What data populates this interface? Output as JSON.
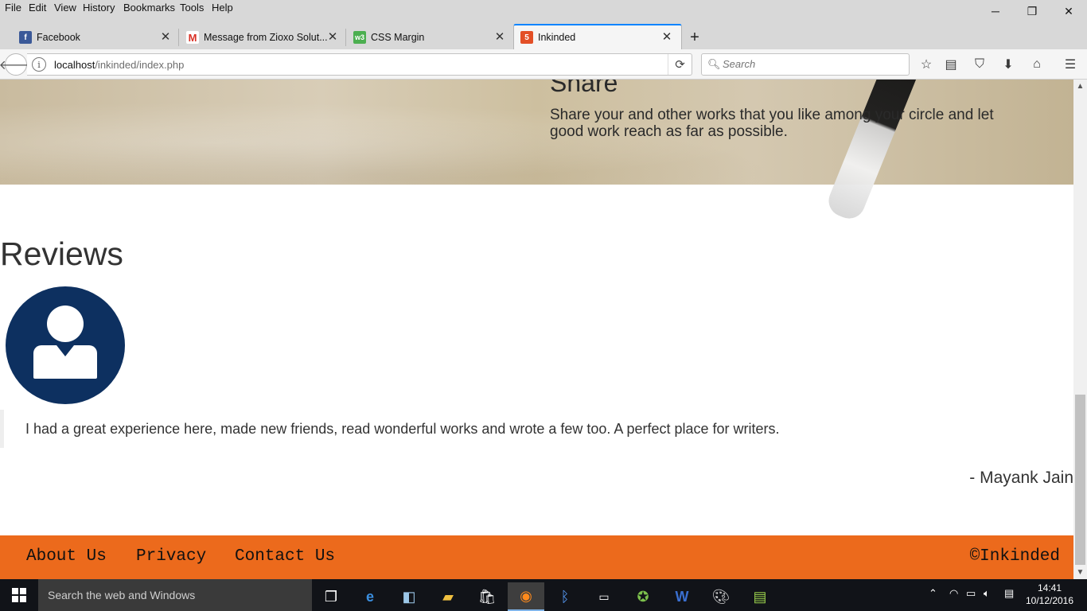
{
  "browser": {
    "menu": [
      "File",
      "Edit",
      "View",
      "History",
      "Bookmarks",
      "Tools",
      "Help"
    ],
    "tabs": [
      {
        "label": "Facebook",
        "favicon": "facebook-icon",
        "active": false
      },
      {
        "label": "Message from Zioxo Solut...",
        "favicon": "gmail-icon",
        "active": false
      },
      {
        "label": "CSS Margin",
        "favicon": "w3schools-icon",
        "active": false
      },
      {
        "label": "Inkinded",
        "favicon": "html5-icon",
        "active": true
      }
    ],
    "url_host": "localhost",
    "url_path": "/inkinded/index.php",
    "search_placeholder": "Search"
  },
  "page": {
    "hero": {
      "title": "Share",
      "text": "Share your and other works that you like among your circle and let good work reach as far as possible."
    },
    "reviews": {
      "heading": "Reviews",
      "items": [
        {
          "text": "I had a great experience here, made new friends, read wonderful works and wrote a few too. A perfect place for writers.",
          "author": "- Mayank Jain"
        }
      ]
    },
    "footer": {
      "links": [
        "About Us",
        "Privacy",
        "Contact Us"
      ],
      "copyright": "©Inkinded"
    }
  },
  "taskbar": {
    "search_placeholder": "Search the web and Windows",
    "time": "14:41",
    "date": "10/12/2016"
  },
  "colors": {
    "footer_bg": "#ec6a1c",
    "avatar_bg": "#0d3060",
    "tab_accent": "#0a84ff"
  }
}
